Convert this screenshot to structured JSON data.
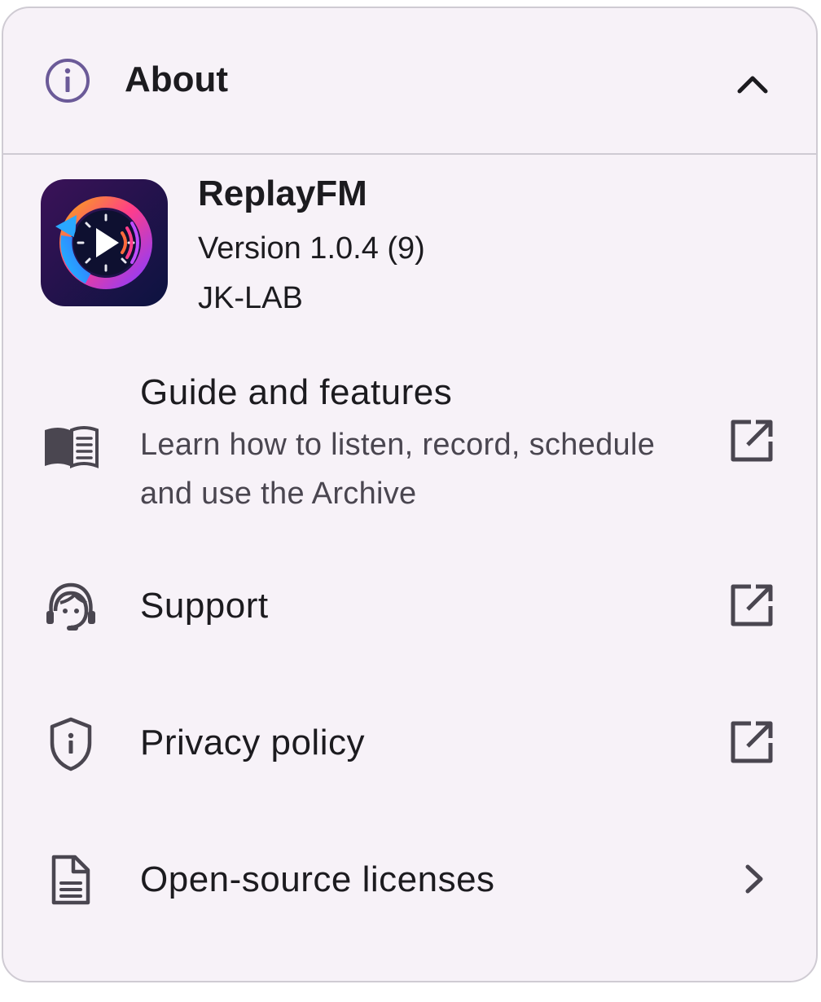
{
  "section": {
    "title": "About",
    "title_icon": "info-icon",
    "collapse_icon": "chevron-up-icon",
    "accent_color": "#6b5a98"
  },
  "app": {
    "name": "ReplayFM",
    "version": "Version 1.0.4 (9)",
    "developer": "JK-LAB",
    "logo_icon": "replay-radio-logo"
  },
  "items": [
    {
      "title": "Guide and features",
      "subtitle": "Learn how to listen, record, schedule and use the Archive",
      "icon": "book-icon",
      "trailing_icon": "open-external-icon"
    },
    {
      "title": "Support",
      "icon": "headset-support-icon",
      "trailing_icon": "open-external-icon"
    },
    {
      "title": "Privacy policy",
      "icon": "shield-info-icon",
      "trailing_icon": "open-external-icon"
    },
    {
      "title": "Open-source licenses",
      "icon": "document-icon",
      "trailing_icon": "chevron-right-icon"
    }
  ]
}
